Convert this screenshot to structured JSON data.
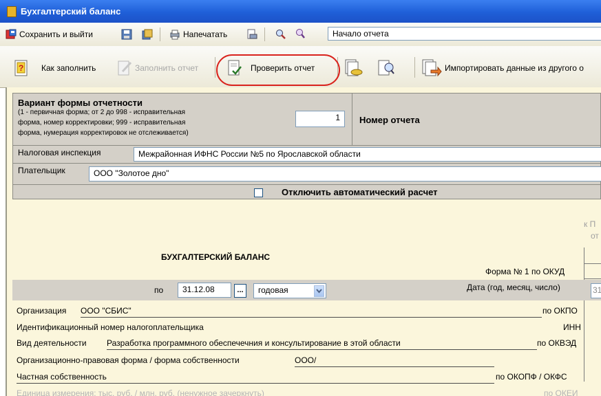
{
  "window": {
    "title": "Бухгалтерский баланс"
  },
  "toolbar1": {
    "save_exit_label": "Сохранить и выйти",
    "print_label": "Напечатать",
    "section_select": "Начало отчета"
  },
  "toolbar2": {
    "how_fill_label": "Как заполнить",
    "fill_report_label": "Заполнить отчет",
    "check_report_label": "Проверить отчет",
    "import_label": "Импортировать данные из другого о"
  },
  "form_header": {
    "variant_title": "Вариант формы отчетности",
    "variant_note_1": "(1 - первичная форма; от 2 до 998 - исправительная",
    "variant_note_2": "форма, номер корректировки; 999 - исправительная",
    "variant_note_3": "форма, нумерация корректировок не отслеживается)",
    "variant_value": "1",
    "report_number_label": "Номер отчета",
    "tax_office_label": "Налоговая инспекция",
    "tax_office_value": "Межрайонная ИФНС России №5 по Ярославской области",
    "payer_label": "Плательщик",
    "payer_value": "ООО \"Золотое дно\"",
    "autocalc_label": "Отключить автоматический расчет"
  },
  "form_body": {
    "corner_text_1": "к П",
    "corner_text_2": "от",
    "balance_title": "БУХГАЛТЕРСКИЙ БАЛАНС",
    "okud_label": "Форма № 1 по ОКУД",
    "po_label": "по",
    "date_value": "31.12.08",
    "browse_label": "...",
    "period_value": "годовая",
    "date_label": "Дата (год, месяц, число)",
    "date_cell_fragment": "31",
    "org_label": "Организация",
    "org_value": "ООО \"СБИС\"",
    "okpo_label": "по ОКПО",
    "inn_row_label": "Идентификационный номер налогоплательщика",
    "inn_label": "ИНН",
    "activity_label": "Вид деятельности",
    "activity_value": "Разработка программного обеспечечния и консультирование в этой области",
    "okved_label": "по ОКВЭД",
    "legal_form_label": "Организационно-правовая форма / форма собственности",
    "legal_form_value": "ООО/",
    "ownership_value": "Частная собственность",
    "okopf_label": "по ОКОПФ / ОКФС",
    "units_label": "Единица измерения: тыс. руб. / млн. руб. (ненужное зачеркнуть)",
    "okei_label": "по ОКЕИ"
  }
}
